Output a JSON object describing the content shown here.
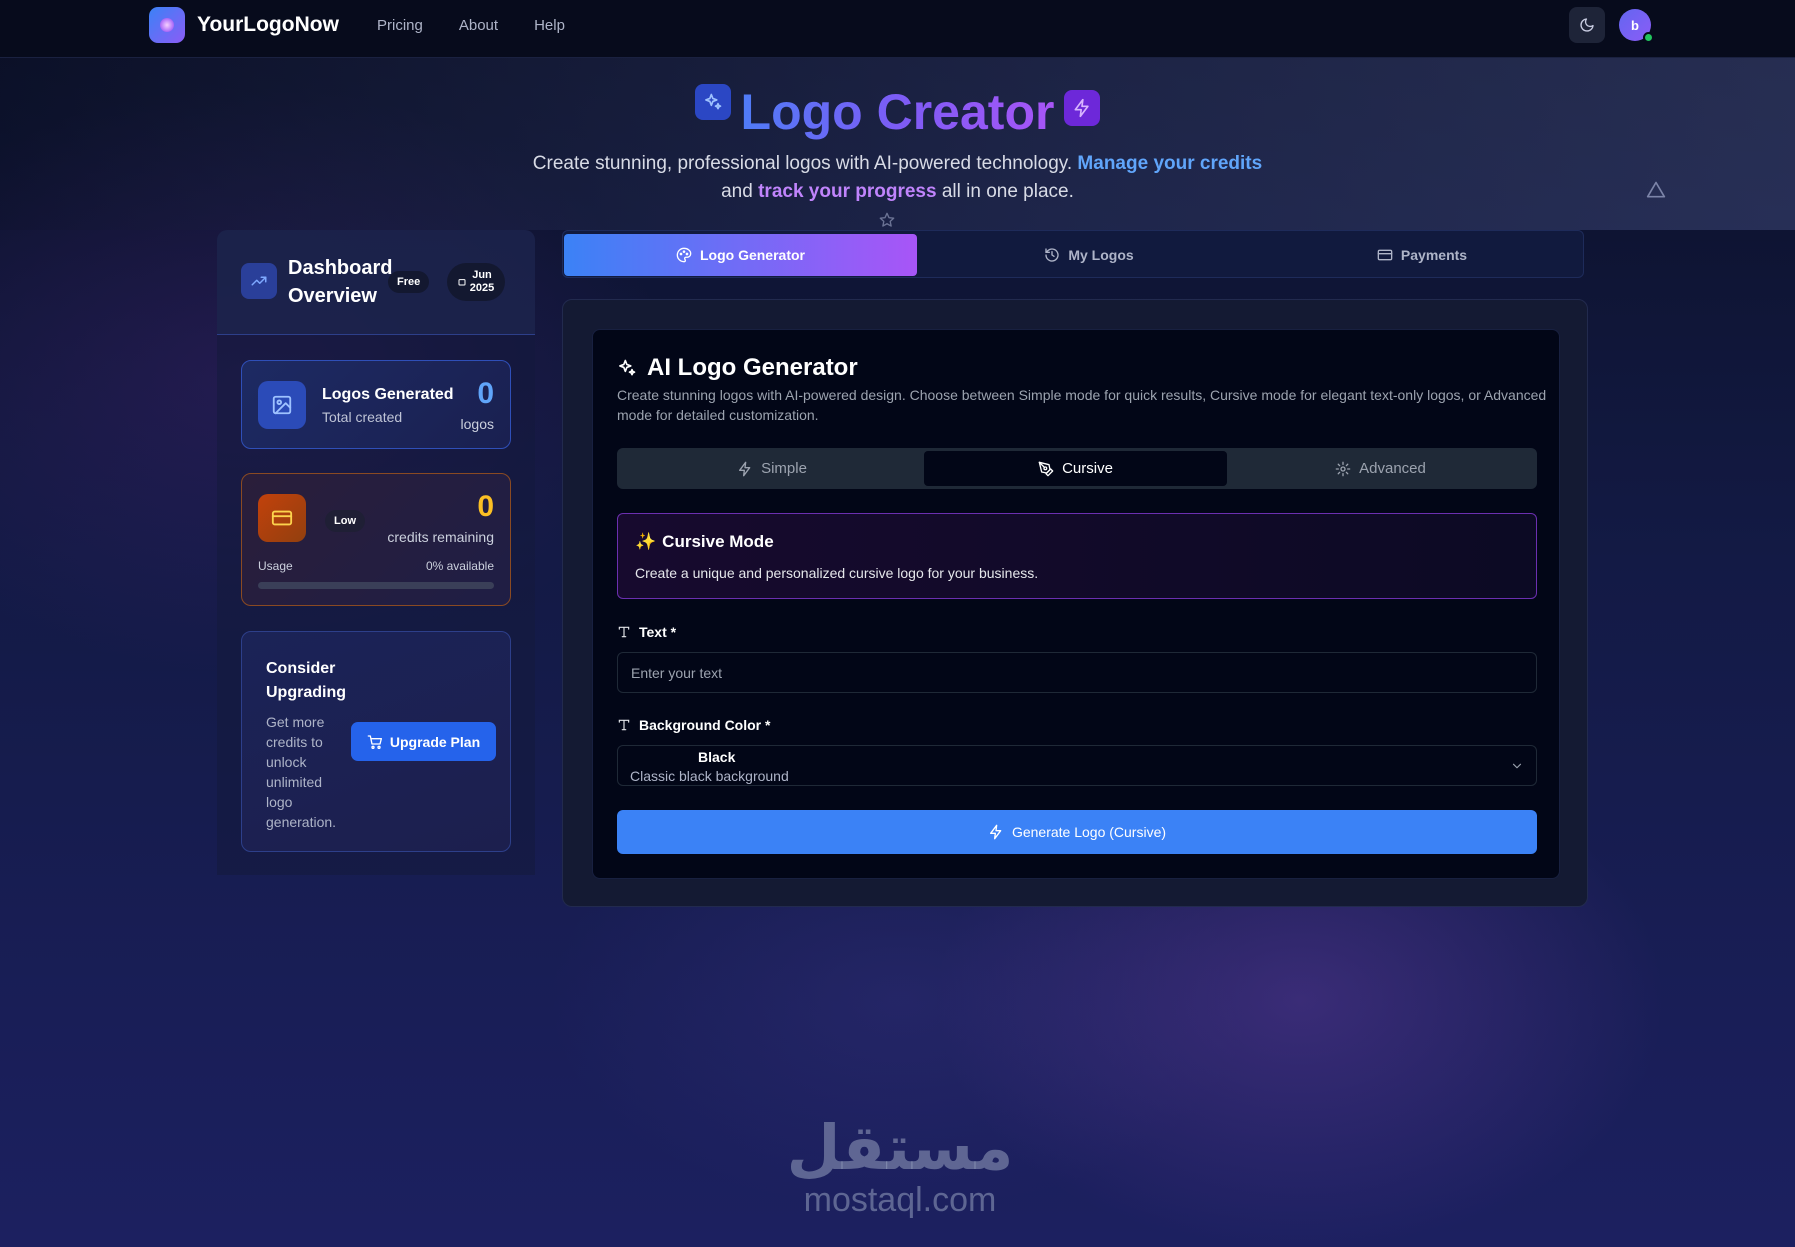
{
  "navbar": {
    "brand": "YourLogoNow",
    "links": [
      "Pricing",
      "About",
      "Help"
    ],
    "avatar_initial": "b"
  },
  "hero": {
    "title": "Logo Creator",
    "subtitle_part1": "Create stunning, professional logos with AI-powered technology.",
    "subtitle_link1": "Manage your credits",
    "subtitle_part2": "and",
    "subtitle_link2": "track your progress",
    "subtitle_part3": "all in one place."
  },
  "sidebar": {
    "title": "Dashboard Overview",
    "plan_badge": "Free",
    "date_month": "Jun",
    "date_year": "2025",
    "logos_card": {
      "title": "Logos Generated",
      "subtitle": "Total created",
      "count": "0",
      "unit": "logos"
    },
    "credits_card": {
      "badge": "Low",
      "count": "0",
      "unit": "credits remaining",
      "usage_label": "Usage",
      "available": "0% available",
      "usage_fraction": 0
    },
    "upgrade_card": {
      "title": "Consider Upgrading",
      "description": "Get more credits to unlock unlimited logo generation.",
      "button": "Upgrade Plan"
    }
  },
  "main_tabs": [
    "Logo Generator",
    "My Logos",
    "Payments"
  ],
  "generator": {
    "title": "AI Logo Generator",
    "description": "Create stunning logos with AI-powered design. Choose between Simple mode for quick results, Cursive mode for elegant text-only logos, or Advanced mode for detailed customization.",
    "modes": [
      "Simple",
      "Cursive",
      "Advanced"
    ],
    "active_mode": "Cursive",
    "mode_panel": {
      "title": "Cursive Mode",
      "description": "Create a unique and personalized cursive logo for your business."
    },
    "text_field": {
      "label": "Text *",
      "placeholder": "Enter your text"
    },
    "bg_field": {
      "label": "Background Color *",
      "selected_name": "Black",
      "selected_description": "Classic black background"
    },
    "generate_button": "Generate Logo (Cursive)"
  },
  "watermark": {
    "arabic": "مستقل",
    "latin": "mostaql.com"
  },
  "colors": {
    "accent_blue": "#3b82f6",
    "accent_purple": "#a855f7",
    "credits_orange": "#fbbf24",
    "online_green": "#22c55e"
  }
}
